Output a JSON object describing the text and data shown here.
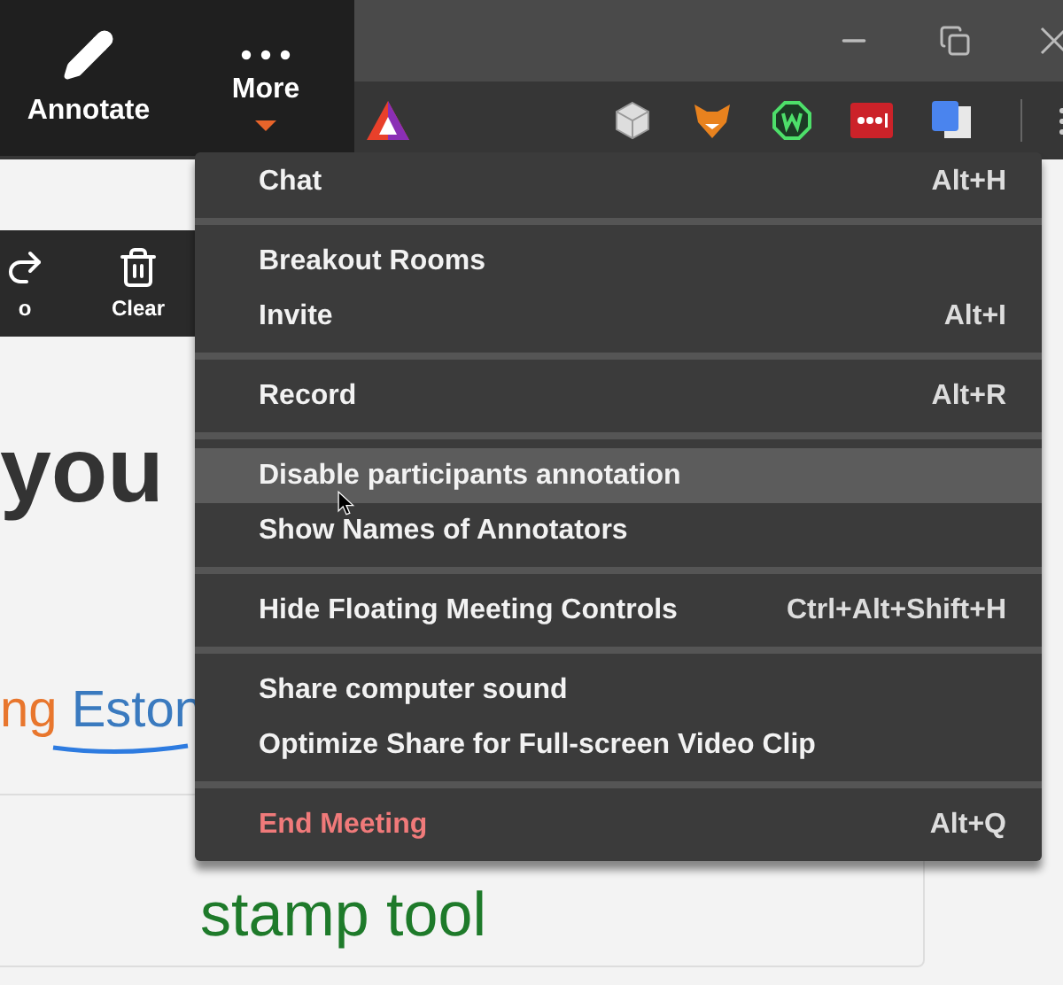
{
  "meeting_controls": [
    {
      "label": "Annotate",
      "kind": "pencil",
      "open": false
    },
    {
      "label": "More",
      "kind": "dots",
      "open": true
    }
  ],
  "annotation_tools": [
    {
      "label": "o",
      "kind": "redo"
    },
    {
      "label": "Clear",
      "kind": "trash"
    }
  ],
  "page": {
    "heading": "you",
    "sentence": [
      {
        "text": "ng",
        "color": "#e8762d"
      },
      {
        "text": "Eston",
        "color": "#3a7abf"
      }
    ],
    "card_lines": [
      "stamp tool"
    ]
  },
  "menu": {
    "groups": [
      [
        {
          "label": "Chat",
          "shortcut": "Alt+H",
          "kind": "normal",
          "highlighted": false
        }
      ],
      [
        {
          "label": "Breakout Rooms",
          "kind": "normal",
          "highlighted": false
        },
        {
          "label": "Invite",
          "shortcut": "Alt+I",
          "kind": "normal",
          "highlighted": false
        }
      ],
      [
        {
          "label": "Record",
          "shortcut": "Alt+R",
          "kind": "normal",
          "highlighted": false
        }
      ],
      [
        {
          "label": "Disable participants annotation",
          "kind": "normal",
          "highlighted": true
        },
        {
          "label": "Show Names of Annotators",
          "kind": "normal",
          "highlighted": false
        }
      ],
      [
        {
          "label": "Hide Floating Meeting Controls",
          "shortcut": "Ctrl+Alt+Shift+H",
          "kind": "normal",
          "highlighted": false
        }
      ],
      [
        {
          "label": "Share computer sound",
          "kind": "normal",
          "highlighted": false
        },
        {
          "label": "Optimize Share for Full-screen Video Clip",
          "kind": "normal",
          "highlighted": false
        }
      ],
      [
        {
          "label": "End Meeting",
          "shortcut": "Alt+Q",
          "kind": "danger",
          "highlighted": false
        }
      ]
    ]
  }
}
